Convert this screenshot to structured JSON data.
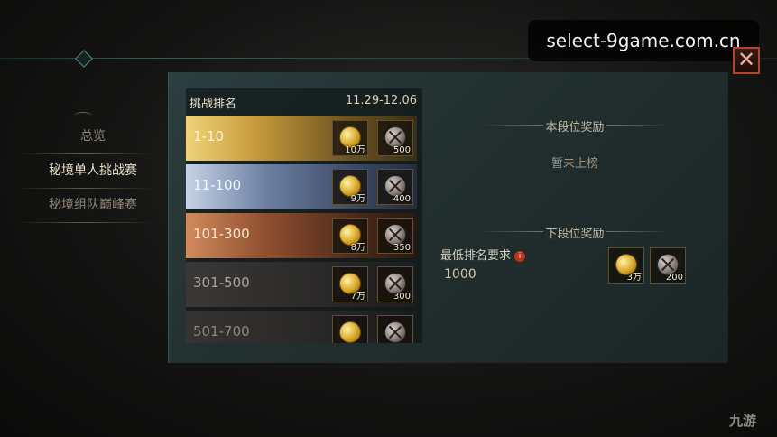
{
  "watermark": "select-9game.com.cn",
  "close": "✕",
  "sidebar": {
    "items": [
      {
        "label": "总览",
        "active": false
      },
      {
        "label": "秘境单人挑战赛",
        "active": true
      },
      {
        "label": "秘境组队巅峰赛",
        "active": false
      }
    ]
  },
  "ranking": {
    "title": "挑战排名",
    "date_range": "11.29-12.06",
    "rows": [
      {
        "range": "1-10",
        "coin": "10万",
        "orb": "500"
      },
      {
        "range": "11-100",
        "coin": "9万",
        "orb": "400"
      },
      {
        "range": "101-300",
        "coin": "8万",
        "orb": "350"
      },
      {
        "range": "301-500",
        "coin": "7万",
        "orb": "300"
      },
      {
        "range": "501-700",
        "coin": "",
        "orb": ""
      }
    ]
  },
  "current_tier": {
    "title": "本段位奖励",
    "status": "暂未上榜"
  },
  "next_tier": {
    "title": "下段位奖励",
    "requirement_label": "最低排名要求",
    "requirement_value": "1000",
    "coin": "3万",
    "orb": "200"
  },
  "corner_logo": "九游",
  "colors": {
    "accent": "#b5442a",
    "gold": "#d8a629",
    "panel": "#22302f"
  }
}
